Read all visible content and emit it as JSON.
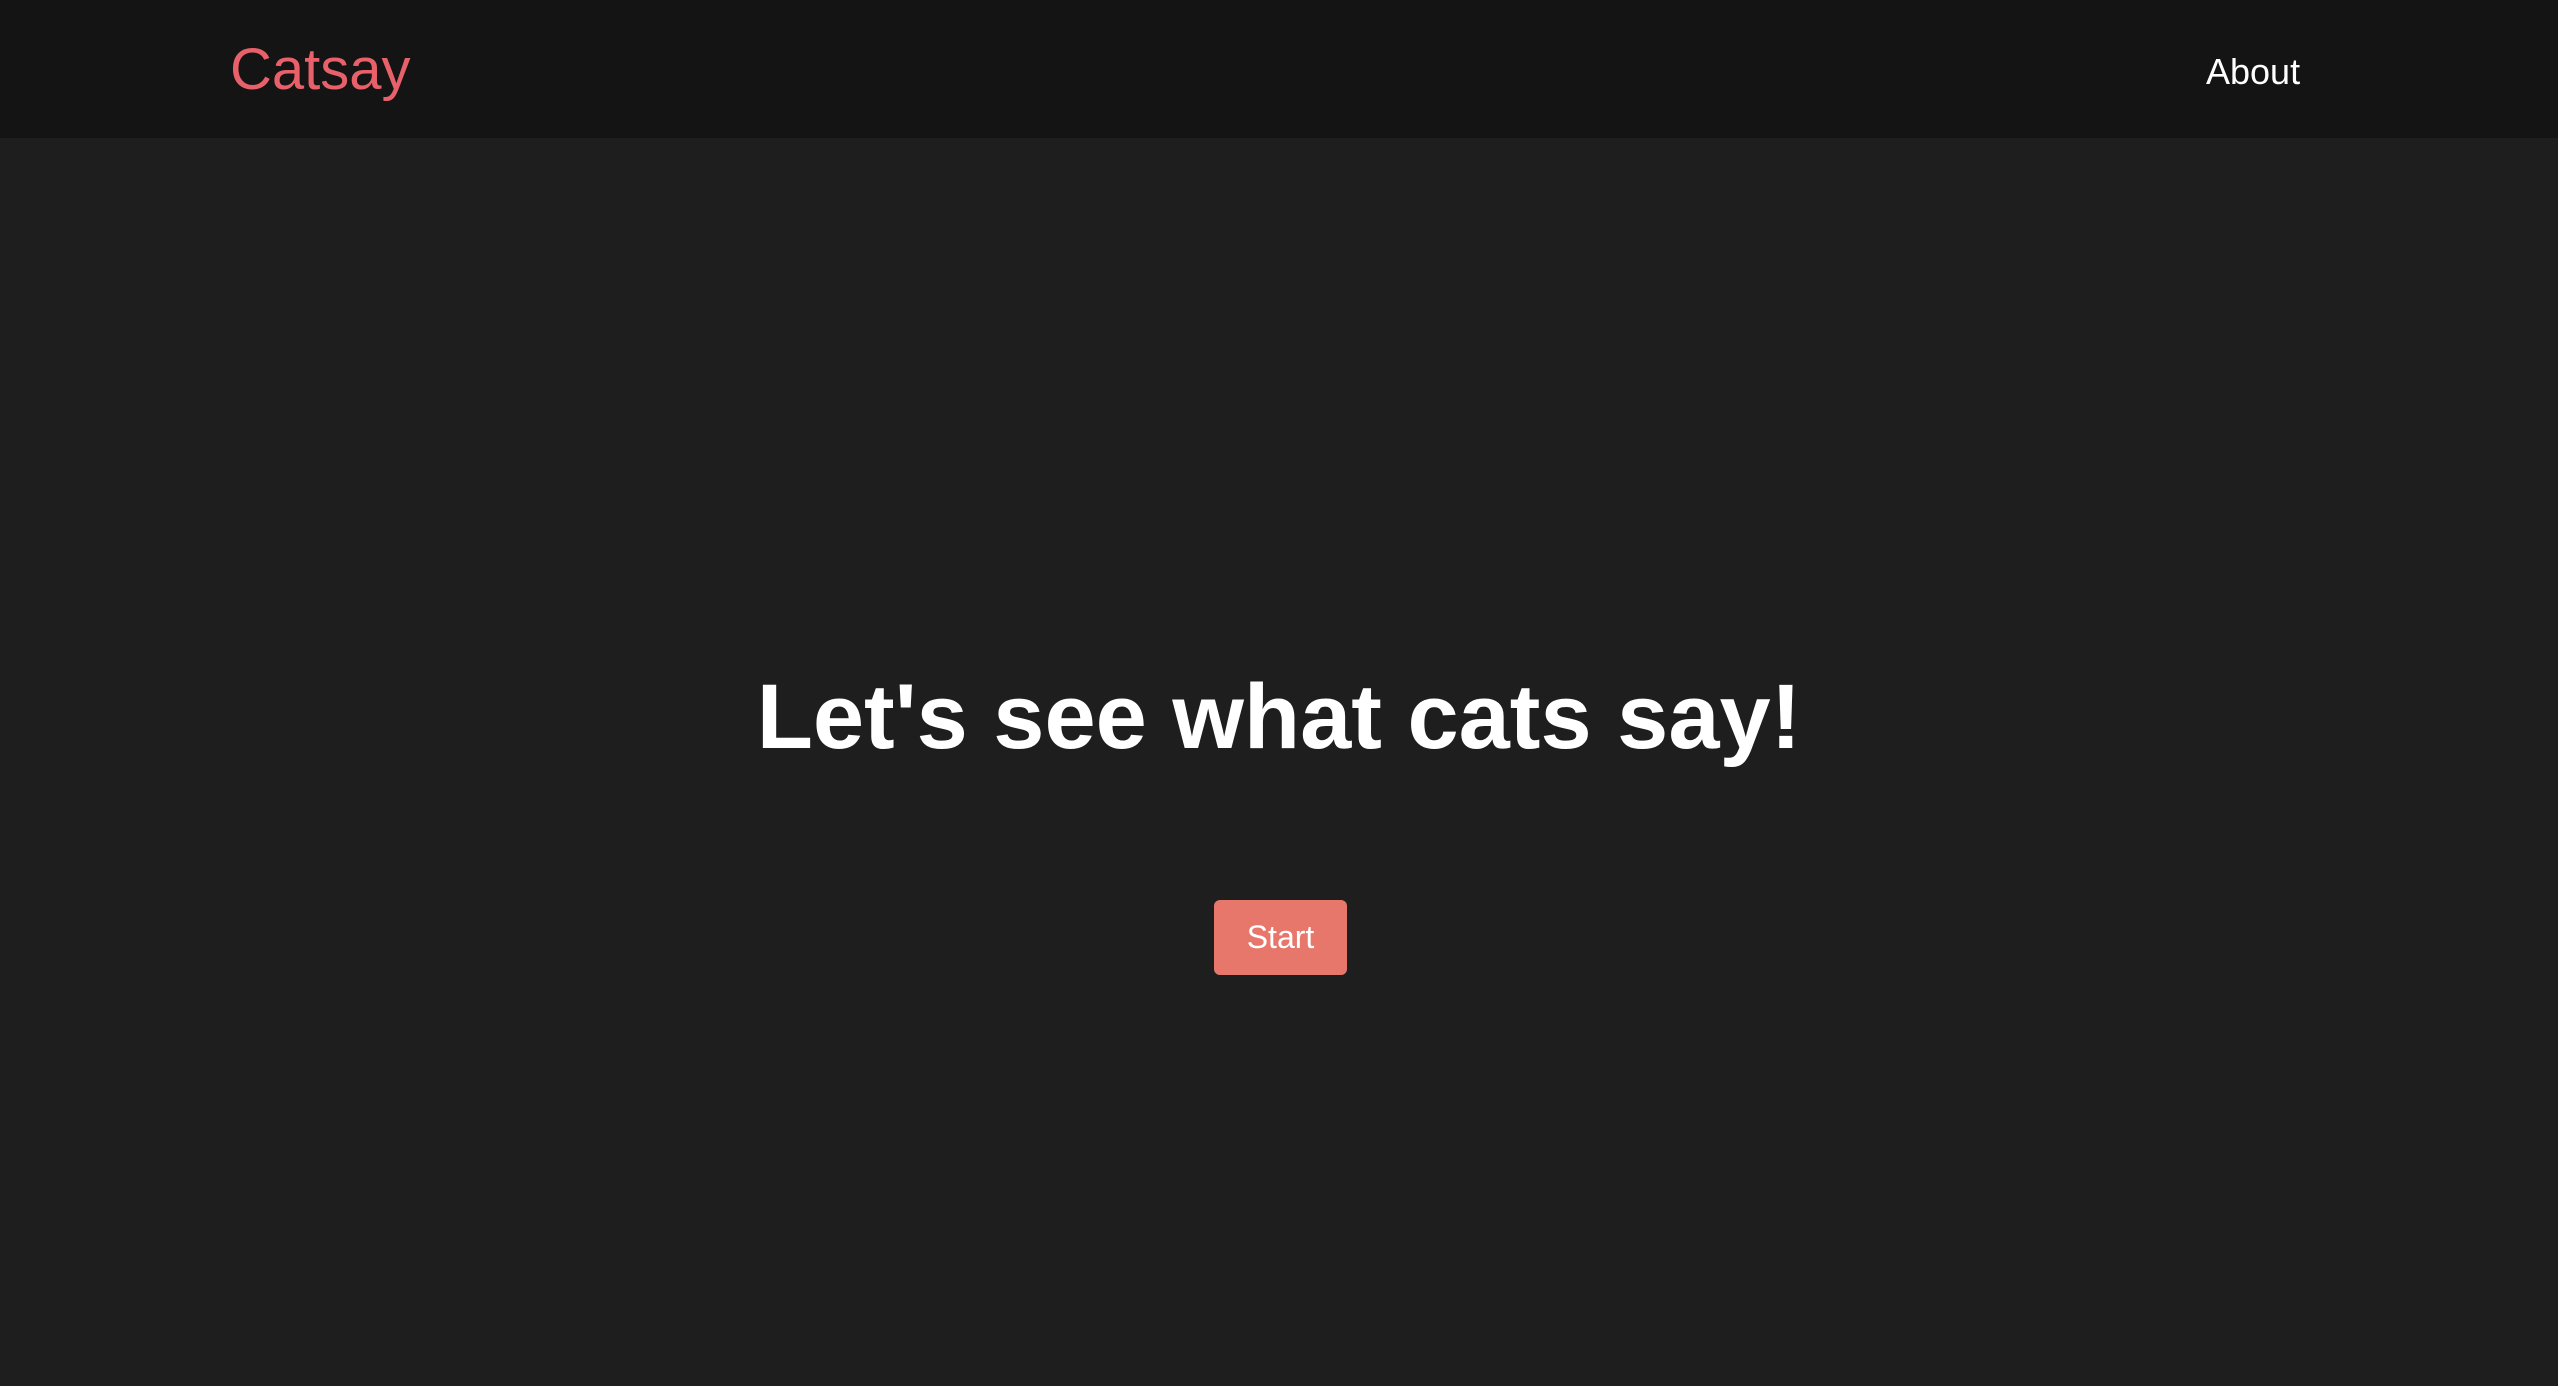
{
  "navbar": {
    "brand": "Catsay",
    "links": [
      {
        "label": "About"
      }
    ]
  },
  "hero": {
    "headline": "Let's see what cats say!",
    "start_label": "Start"
  },
  "colors": {
    "brand": "#e8616a",
    "button": "#e8776b",
    "navbar_background": "#141414",
    "page_background": "#1e1e1e",
    "text": "#ffffff"
  }
}
